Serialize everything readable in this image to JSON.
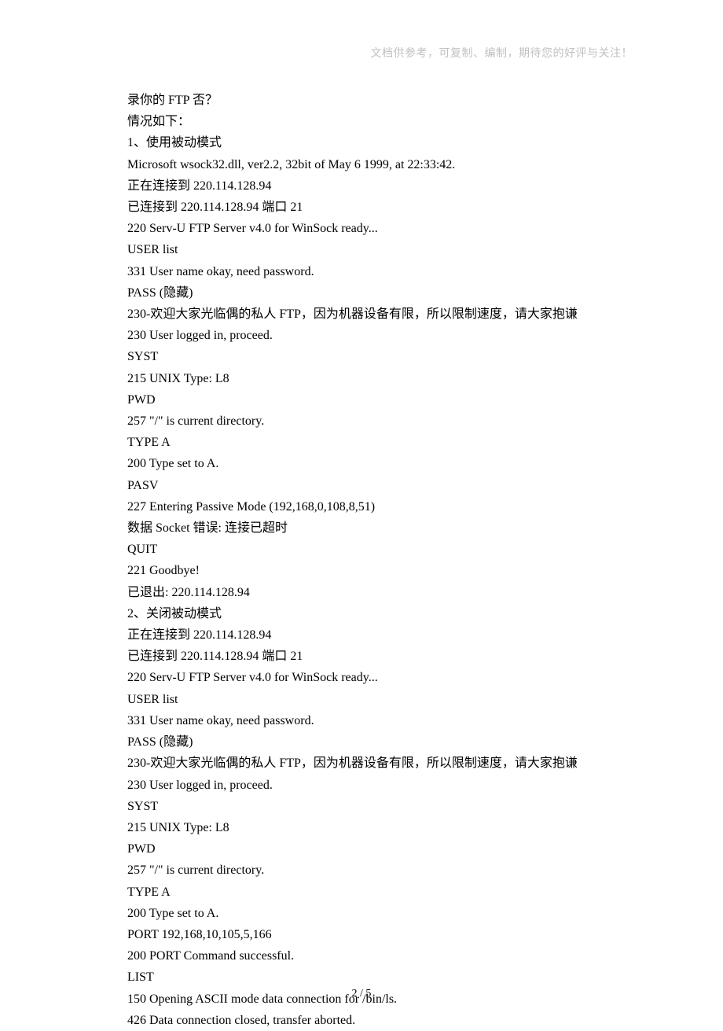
{
  "header_note": "文档供参考，可复制、编制，期待您的好评与关注！",
  "page_number": "2 / 5",
  "content_lines": [
    "录你的 FTP 否？",
    "情况如下：",
    "1、使用被动模式",
    "Microsoft wsock32.dll, ver2.2, 32bit of May  6 1999, at 22:33:42.",
    "正在连接到  220.114.128.94",
    "已连接到  220.114.128.94  端口  21",
    "220 Serv-U FTP Server v4.0 for WinSock ready...",
    "USER list",
    "331 User name okay, need password.",
    "PASS (隐藏)",
    "230-欢迎大家光临偶的私人 FTP，因为机器设备有限，所以限制速度，请大家抱谦",
    "230 User logged in, proceed.",
    "SYST",
    "215 UNIX Type: L8",
    "PWD",
    "257 \"/\" is current directory.",
    "TYPE A",
    "200 Type set to A.",
    "PASV",
    "227 Entering Passive Mode (192,168,0,108,8,51)",
    "数据  Socket  错误: 连接已超时",
    "QUIT",
    "221 Goodbye!",
    "已退出: 220.114.128.94",
    "2、关闭被动模式",
    "正在连接到  220.114.128.94",
    "已连接到  220.114.128.94  端口  21",
    "220 Serv-U FTP Server v4.0 for WinSock ready...",
    "USER list",
    "331 User name okay, need password.",
    "PASS (隐藏)",
    "230-欢迎大家光临偶的私人 FTP，因为机器设备有限，所以限制速度，请大家抱谦",
    "230 User logged in, proceed.",
    "SYST",
    "215 UNIX Type: L8",
    "PWD",
    "257 \"/\" is current directory.",
    "TYPE A",
    "200 Type set to A.",
    "PORT 192,168,10,105,5,166",
    "200 PORT Command successful.",
    "LIST",
    "150 Opening ASCII mode data connection for /bin/ls.",
    "426 Data connection closed, transfer aborted."
  ]
}
